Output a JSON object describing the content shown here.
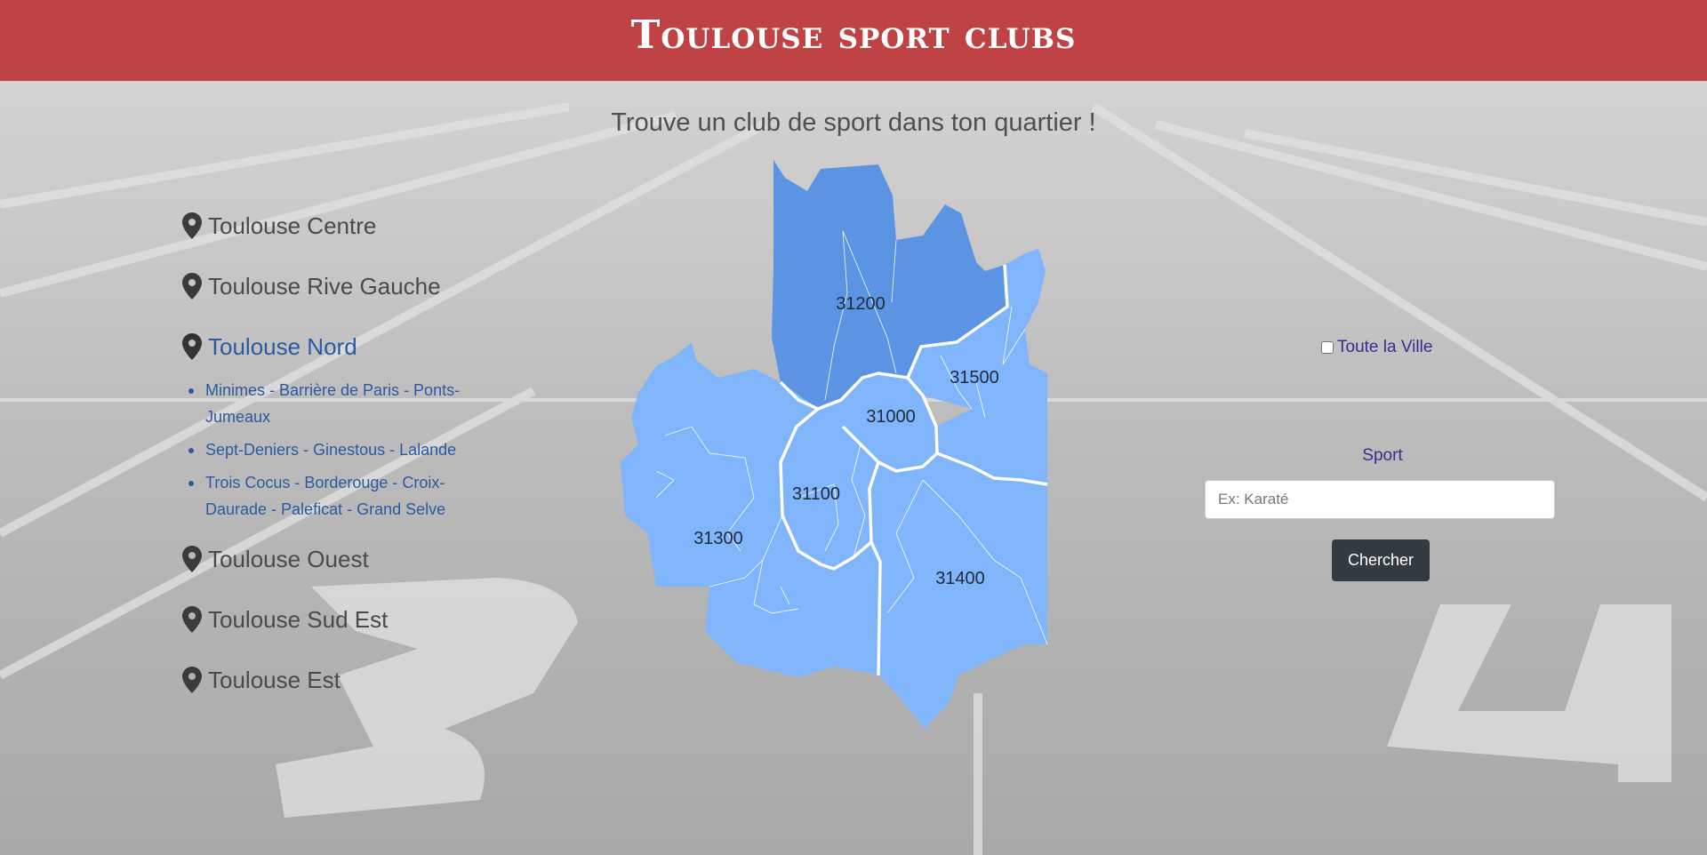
{
  "header": {
    "title": "Toulouse sport clubs"
  },
  "subtitle": "Trouve un club de sport dans ton quartier !",
  "districts": [
    {
      "label": "Toulouse Centre"
    },
    {
      "label": "Toulouse Rive Gauche"
    },
    {
      "label": "Toulouse Nord",
      "active": true,
      "subitems": [
        "Minimes - Barrière de Paris - Ponts-Jumeaux",
        "Sept-Deniers - Ginestous - Lalande",
        "Trois Cocus - Borderouge - Croix-Daurade - Paleficat - Grand Selve"
      ]
    },
    {
      "label": "Toulouse Ouest"
    },
    {
      "label": "Toulouse Sud Est"
    },
    {
      "label": "Toulouse Est"
    }
  ],
  "map": {
    "zip_codes": [
      "31200",
      "31500",
      "31000",
      "31100",
      "31300",
      "31400"
    ],
    "colors": {
      "highlight": "#5a94e3",
      "base": "#80b5fb",
      "border": "#ffffff"
    }
  },
  "search": {
    "checkbox_label": "Toute la Ville",
    "checked": false,
    "sport_label": "Sport",
    "placeholder": "Ex: Karaté",
    "value": "",
    "button_label": "Chercher"
  },
  "colors": {
    "header": "#bf4345",
    "active_link": "#2b5aa0",
    "label": "#3b2a8f",
    "button": "#333a40"
  }
}
